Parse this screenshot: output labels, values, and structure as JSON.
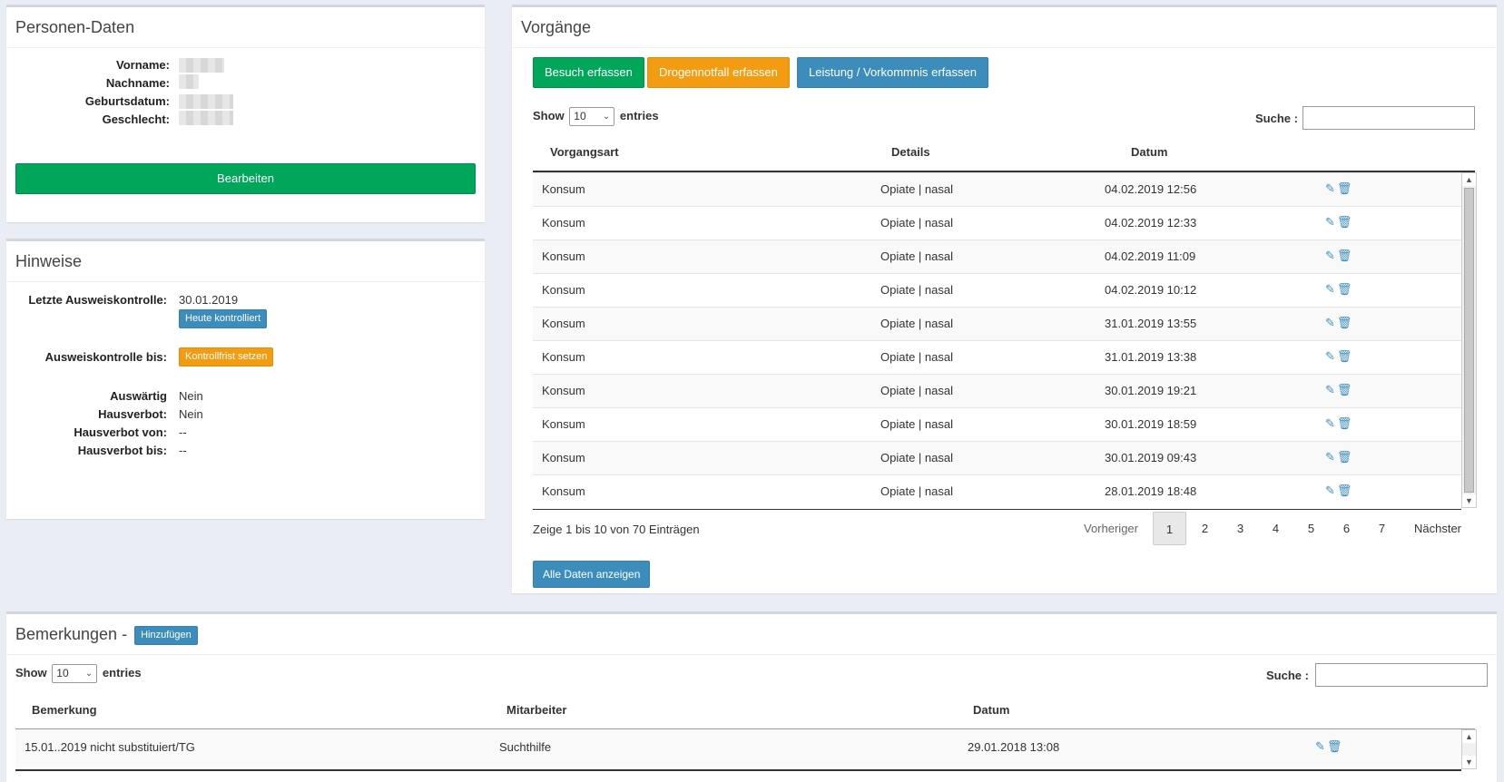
{
  "personen": {
    "title": "Personen-Daten",
    "fields": [
      {
        "label": "Vorname:"
      },
      {
        "label": "Nachname:"
      },
      {
        "label": "Geburtsdatum:"
      },
      {
        "label": "Geschlecht:"
      }
    ],
    "edit_button": "Bearbeiten"
  },
  "hinweise": {
    "title": "Hinweise",
    "letzte_label": "Letzte Ausweiskontrolle:",
    "letzte_value": "30.01.2019",
    "heute_button": "Heute kontrolliert",
    "bis_label": "Ausweiskontrolle bis:",
    "frist_button": "Kontrollfrist setzen",
    "rows": [
      {
        "label": "Auswärtig",
        "value": "Nein"
      },
      {
        "label": "Hausverbot:",
        "value": "Nein"
      },
      {
        "label": "Hausverbot von:",
        "value": "--"
      },
      {
        "label": "Hausverbot bis:",
        "value": "--"
      }
    ]
  },
  "vorgaenge": {
    "title": "Vorgänge",
    "buttons": {
      "besuch": "Besuch erfassen",
      "notfall": "Drogennotfall erfassen",
      "leistung": "Leistung / Vorkommnis erfassen"
    },
    "show": "Show",
    "entries_value": "10",
    "entries": "entries",
    "search_label": "Suche :",
    "columns": [
      "Vorgangsart",
      "Details",
      "Datum"
    ],
    "rows": [
      {
        "art": "Konsum",
        "details": "Opiate | nasal",
        "datum": "04.02.2019 12:56"
      },
      {
        "art": "Konsum",
        "details": "Opiate | nasal",
        "datum": "04.02.2019 12:33"
      },
      {
        "art": "Konsum",
        "details": "Opiate | nasal",
        "datum": "04.02.2019 11:09"
      },
      {
        "art": "Konsum",
        "details": "Opiate | nasal",
        "datum": "04.02.2019 10:12"
      },
      {
        "art": "Konsum",
        "details": "Opiate | nasal",
        "datum": "31.01.2019 13:55"
      },
      {
        "art": "Konsum",
        "details": "Opiate | nasal",
        "datum": "31.01.2019 13:38"
      },
      {
        "art": "Konsum",
        "details": "Opiate | nasal",
        "datum": "30.01.2019 19:21"
      },
      {
        "art": "Konsum",
        "details": "Opiate | nasal",
        "datum": "30.01.2019 18:59"
      },
      {
        "art": "Konsum",
        "details": "Opiate | nasal",
        "datum": "30.01.2019 09:43"
      },
      {
        "art": "Konsum",
        "details": "Opiate | nasal",
        "datum": "28.01.2019 18:48"
      }
    ],
    "info": "Zeige 1 bis 10 von 70 Einträgen",
    "pagination": {
      "prev": "Vorheriger",
      "pages": [
        "1",
        "2",
        "3",
        "4",
        "5",
        "6",
        "7"
      ],
      "next": "Nächster"
    },
    "all_button": "Alle Daten anzeigen"
  },
  "bemerkungen": {
    "title": "Bemerkungen -",
    "add_button": "Hinzufügen",
    "show": "Show",
    "entries_value": "10",
    "entries": "entries",
    "search_label": "Suche :",
    "columns": [
      "Bemerkung",
      "Mitarbeiter",
      "Datum"
    ],
    "rows": [
      {
        "bemerkung": "15.01..2019 nicht substituiert/TG",
        "mitarbeiter": "Suchthilfe",
        "datum": "29.01.2018 13:08"
      }
    ]
  },
  "icons": {
    "edit": "pencil-icon",
    "delete": "trash-icon"
  },
  "colors": {
    "green": "#00a65a",
    "blue": "#3c8dbc",
    "orange": "#f39c12"
  }
}
